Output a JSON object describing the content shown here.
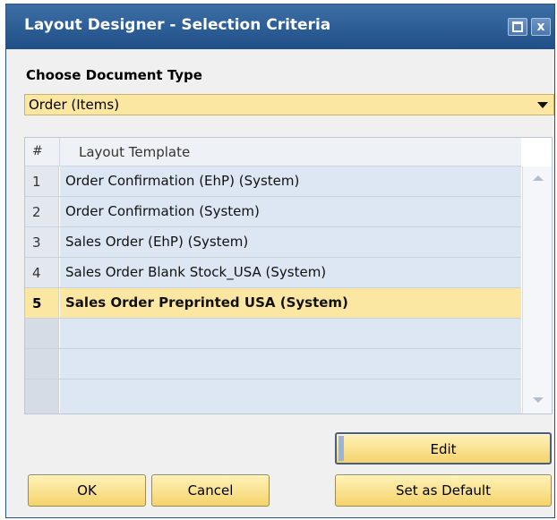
{
  "window": {
    "title": "Layout Designer - Selection Criteria",
    "minimize_label": "",
    "close_label": "x"
  },
  "document_type": {
    "label": "Choose Document Type",
    "selected": "Order (Items)"
  },
  "grid": {
    "columns": {
      "number": "#",
      "template": "Layout Template"
    },
    "rows": [
      {
        "num": "1",
        "template": "Order Confirmation (EhP) (System)"
      },
      {
        "num": "2",
        "template": "Order Confirmation (System)"
      },
      {
        "num": "3",
        "template": "Sales Order (EhP) (System)"
      },
      {
        "num": "4",
        "template": "Sales Order Blank Stock_USA (System)"
      },
      {
        "num": "5",
        "template": "Sales Order Preprinted USA (System)",
        "selected": true
      }
    ],
    "empty_rows": 3
  },
  "buttons": {
    "edit": "Edit",
    "ok": "OK",
    "cancel": "Cancel",
    "set_as_default": "Set as Default"
  },
  "colors": {
    "title_bar": "#2b5d95",
    "selection": "#fce7a2",
    "row": "#dde7f3",
    "button": "#f4d36b"
  }
}
